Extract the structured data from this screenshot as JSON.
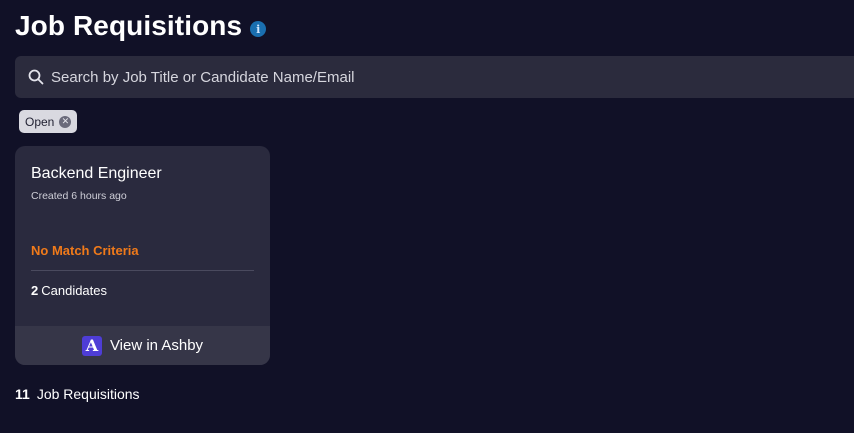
{
  "header": {
    "title": "Job Requisitions",
    "info_icon": "info-icon"
  },
  "search": {
    "placeholder": "Search by Job Title or Candidate Name/Email",
    "value": ""
  },
  "filters": [
    {
      "label": "Open"
    }
  ],
  "cards": [
    {
      "title": "Backend Engineer",
      "created": "Created 6 hours ago",
      "match_criteria": "No Match Criteria",
      "candidates_count": "2",
      "candidates_label": "Candidates",
      "action_label": "View in Ashby",
      "action_icon": "ashby-logo-icon"
    }
  ],
  "total": {
    "count": "11",
    "label": "Job Requisitions"
  },
  "colors": {
    "background": "#111127",
    "card": "#2a2a3e",
    "accent_orange": "#f07a1a",
    "ashby_purple": "#4e3dd6"
  }
}
